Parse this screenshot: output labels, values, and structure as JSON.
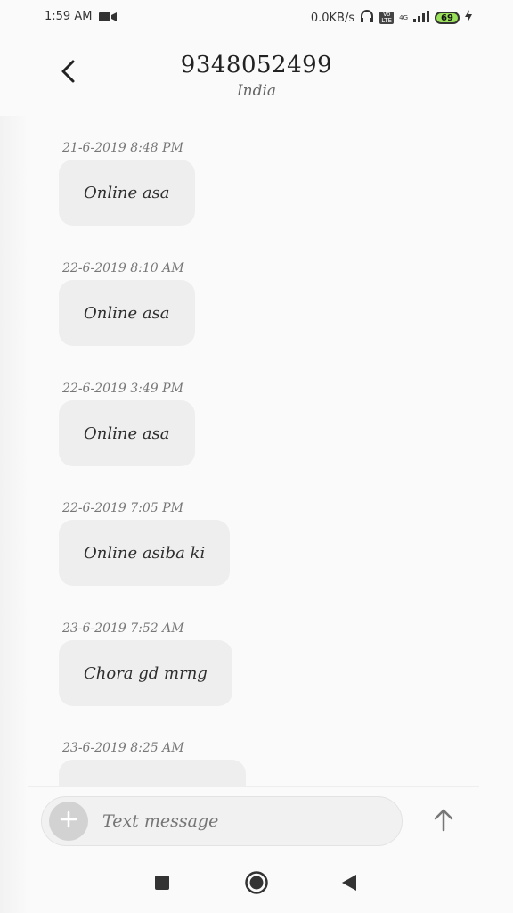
{
  "status_bar": {
    "time": "1:59 AM",
    "net_speed": "0.0KB/s",
    "volte_badge": "Vo LTE",
    "signal_label": "4G",
    "battery": "69"
  },
  "header": {
    "title": "9348052499",
    "subtitle": "India"
  },
  "messages": [
    {
      "time": "21-6-2019 8:48 PM",
      "text": "Online asa"
    },
    {
      "time": "22-6-2019 8:10 AM",
      "text": "Online asa"
    },
    {
      "time": "22-6-2019 3:49 PM",
      "text": "Online asa"
    },
    {
      "time": "22-6-2019 7:05 PM",
      "text": "Online asiba ki"
    },
    {
      "time": "23-6-2019 7:52 AM",
      "text": "Chora gd mrng"
    },
    {
      "time": "23-6-2019 8:25 AM",
      "text": ""
    }
  ],
  "composer": {
    "placeholder": "Text message"
  },
  "icons": {
    "back": "chevron-left-icon",
    "plus": "plus-icon",
    "send": "arrow-up-icon",
    "nav_recents": "square-icon",
    "nav_home": "circle-icon",
    "nav_back": "triangle-left-icon"
  }
}
